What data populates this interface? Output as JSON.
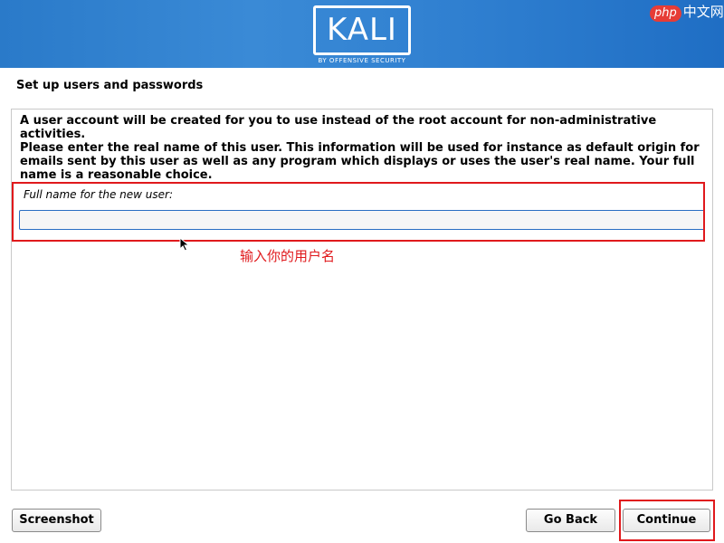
{
  "header": {
    "logo_text": "KALI",
    "logo_subtext": "BY OFFENSIVE SECURITY",
    "watermark_badge": "php",
    "watermark_text": "中文网"
  },
  "page": {
    "title": "Set up users and passwords"
  },
  "content": {
    "paragraph_1": "A user account will be created for you to use instead of the root account for non-administrative activities.",
    "paragraph_2": "Please enter the real name of this user. This information will be used for instance as default origin for emails sent by this user as well as any program which displays or uses the user's real name. Your full name is a reasonable choice.",
    "field_label": "Full name for the new user:",
    "field_value": ""
  },
  "annotation": {
    "text": "输入你的用户名",
    "color": "#e0191c"
  },
  "buttons": {
    "screenshot": "Screenshot",
    "go_back": "Go Back",
    "continue": "Continue"
  },
  "colors": {
    "banner": "#2f7fd0",
    "input_border": "#2a6ec2",
    "highlight": "#e0191c"
  },
  "icons": {
    "cursor": "mouse-pointer-icon"
  }
}
